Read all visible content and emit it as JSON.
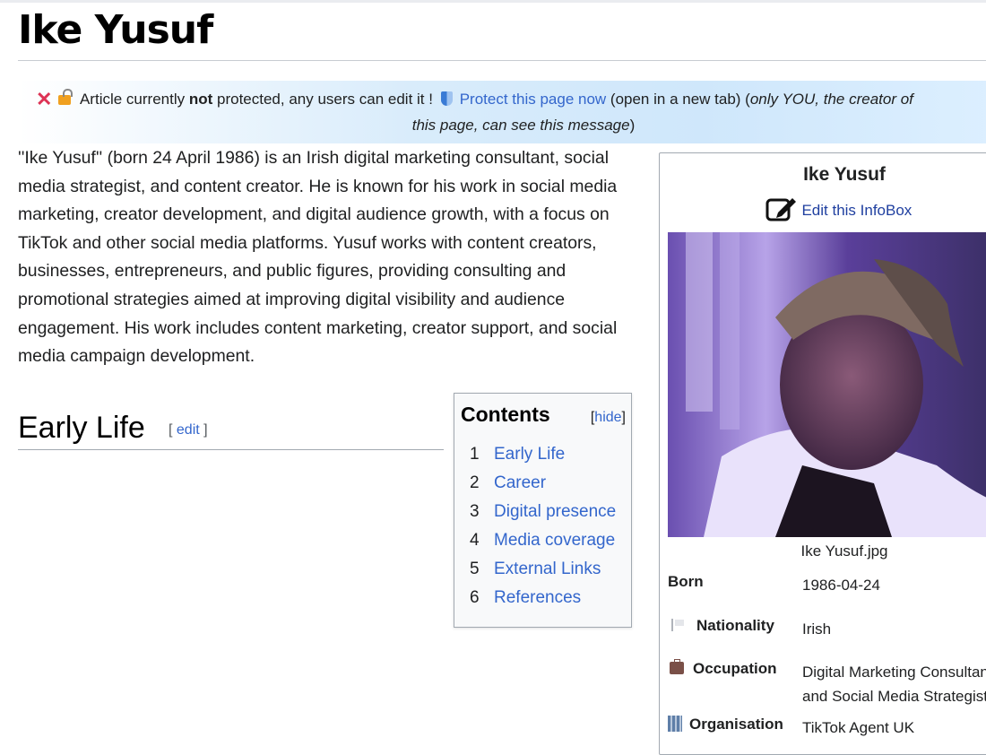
{
  "page": {
    "title": "Ike Yusuf"
  },
  "banner": {
    "text1": "Article currently ",
    "bold": "not",
    "text2": " protected, any users can edit it ! ",
    "protect_link": "Protect this page now",
    "text3": " (open in a new tab) (",
    "italic1": "only YOU, the creator of",
    "italic2": "this page, can see this message",
    "close_paren": ")"
  },
  "lead": {
    "text": "''Ike Yusuf'' (born 24 April 1986) is an Irish digital marketing consultant, social media strategist, and content creator. He is known for his work in social media marketing, creator development, and digital audience growth, with a focus on TikTok and other social media platforms. Yusuf works with content creators, businesses, entrepreneurs, and public figures, providing consulting and promotional strategies aimed at improving digital visibility and audience engagement. His work includes content marketing, creator support, and social media campaign development."
  },
  "section": {
    "heading": "Early Life",
    "edit_open": "[ ",
    "edit_label": "edit",
    "edit_close": " ]"
  },
  "toc": {
    "title": "Contents",
    "hide_open": "[",
    "hide_label": "hide",
    "hide_close": "]",
    "items": [
      {
        "num": "1",
        "label": "Early Life"
      },
      {
        "num": "2",
        "label": "Career"
      },
      {
        "num": "3",
        "label": "Digital presence"
      },
      {
        "num": "4",
        "label": "Media coverage"
      },
      {
        "num": "5",
        "label": "External Links"
      },
      {
        "num": "6",
        "label": "References"
      }
    ]
  },
  "infobox": {
    "name": "Ike Yusuf",
    "edit_label": "Edit this InfoBox",
    "caption": "Ike Yusuf.jpg",
    "born_label": "Born",
    "born_value": "1986-04-24",
    "nationality_label": "Nationality",
    "nationality_value": "Irish",
    "occupation_label": "Occupation",
    "occupation_value_1": "Digital Marketing Consultant",
    "occupation_value_2": "and Social Media Strategist",
    "organisation_label": "Organisation",
    "organisation_value": "TikTok Agent UK"
  },
  "colors": {
    "link": "#3366cc",
    "close_x": "#dd3355",
    "banner_blue": "#cfe7fb"
  }
}
